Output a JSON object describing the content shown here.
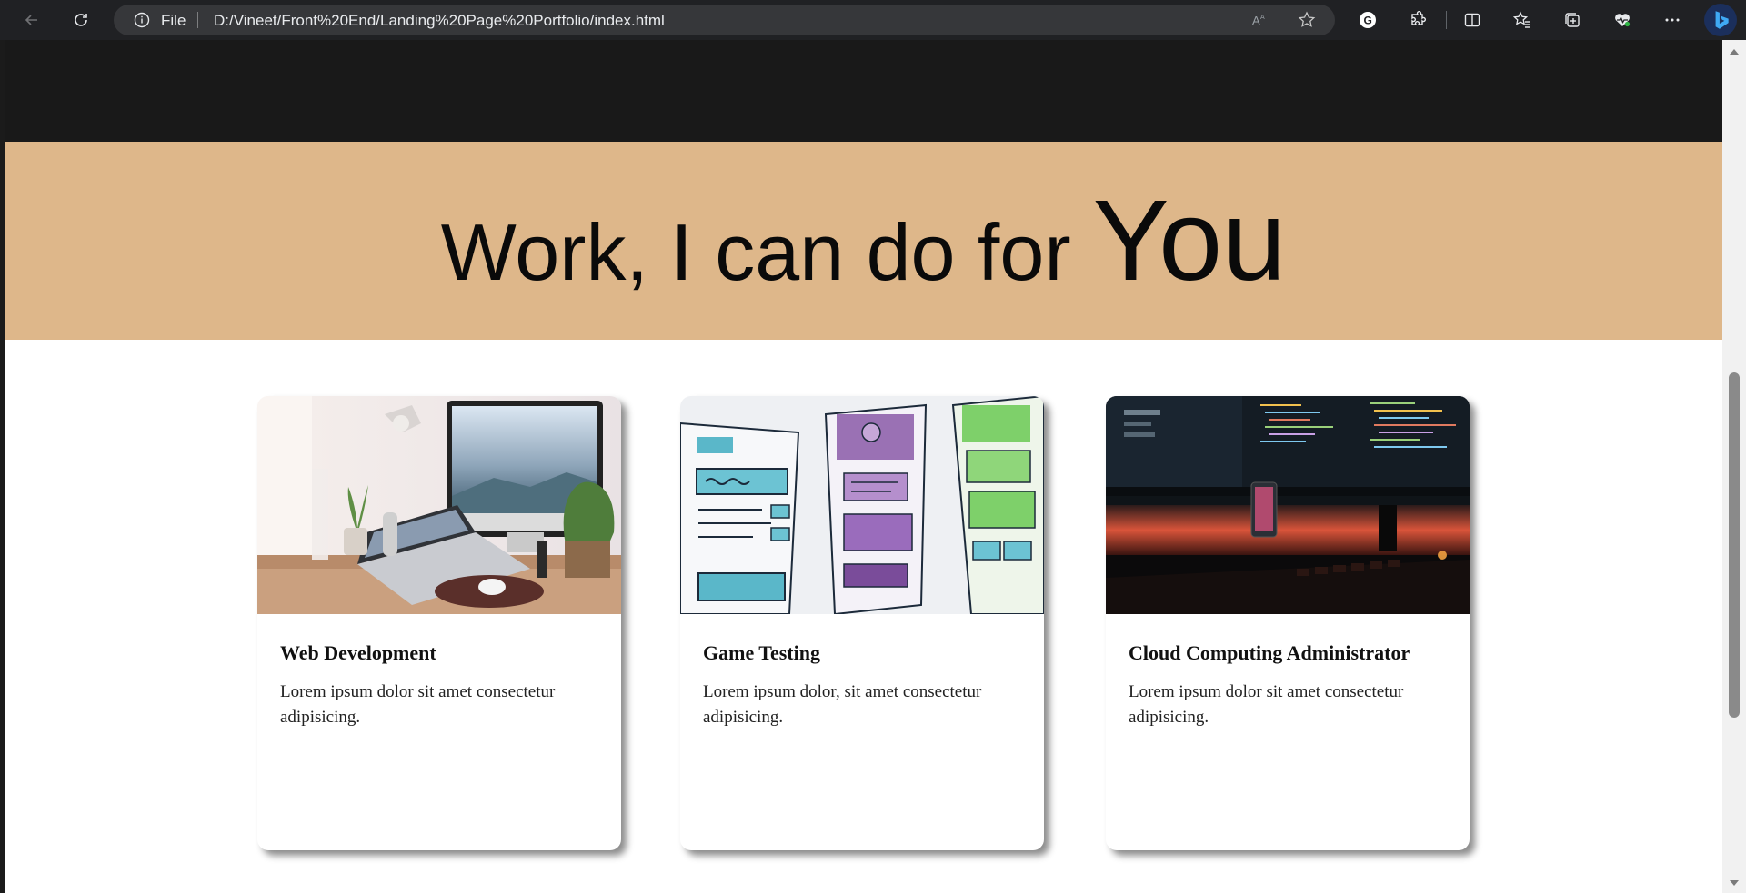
{
  "browser": {
    "address_scheme": "File",
    "url": "D:/Vineet/Front%20End/Landing%20Page%20Portfolio/index.html",
    "icons": [
      "back-icon",
      "refresh-icon",
      "info-icon",
      "read-aloud-icon",
      "favorite-star-icon",
      "extension-g-icon",
      "extensions-puzzle-icon",
      "split-screen-icon",
      "favorites-icon",
      "collections-icon",
      "browser-essentials-icon",
      "more-menu-icon",
      "bing-copilot-icon"
    ]
  },
  "hero": {
    "title_main": "Work, I can do for",
    "title_emphasis": "You",
    "background": "#deb78a"
  },
  "services": [
    {
      "title": "Web Development",
      "text": "Lorem ipsum dolor sit amet consectetur adipisicing.",
      "image": "laptop-desk-photo"
    },
    {
      "title": "Game Testing",
      "text": "Lorem ipsum dolor, sit amet consectetur adipisicing.",
      "image": "wireframe-sketch-photo"
    },
    {
      "title": "Cloud Computing Administrator",
      "text": "Lorem ipsum dolor sit amet consectetur adipisicing.",
      "image": "code-monitors-photo"
    }
  ],
  "colors": {
    "header_dark": "#191919",
    "chrome": "#202124",
    "accent_blue": "#0f6cbd"
  }
}
